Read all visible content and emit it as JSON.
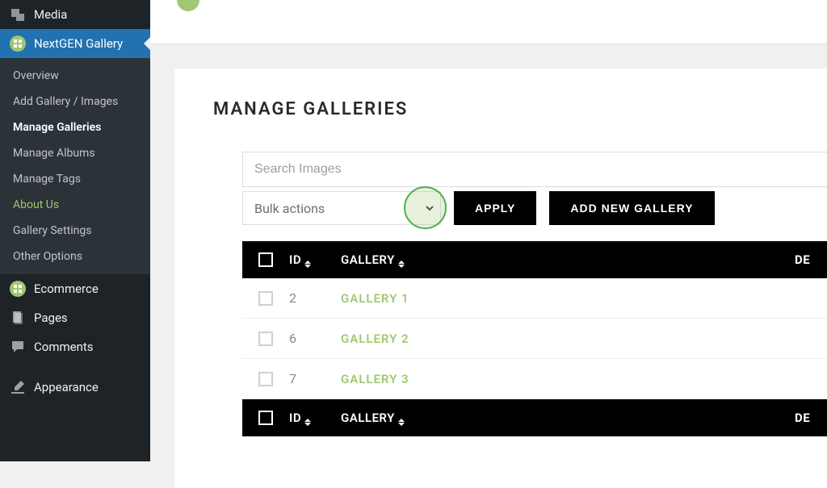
{
  "sidebar": {
    "media_label": "Media",
    "nextgen_label": "NextGEN Gallery",
    "submenu": [
      {
        "label": "Overview"
      },
      {
        "label": "Add Gallery / Images"
      },
      {
        "label": "Manage Galleries"
      },
      {
        "label": "Manage Albums"
      },
      {
        "label": "Manage Tags"
      },
      {
        "label": "About Us"
      },
      {
        "label": "Gallery Settings"
      },
      {
        "label": "Other Options"
      }
    ],
    "ecommerce_label": "Ecommerce",
    "pages_label": "Pages",
    "comments_label": "Comments",
    "appearance_label": "Appearance"
  },
  "page": {
    "title": "MANAGE GALLERIES",
    "search_placeholder": "Search Images",
    "bulk_label": "Bulk actions",
    "apply_label": "APPLY",
    "add_new_label": "ADD NEW GALLERY"
  },
  "table": {
    "header_id": "ID",
    "header_gallery": "GALLERY",
    "header_de": "DE",
    "rows": [
      {
        "id": "2",
        "name": "GALLERY 1"
      },
      {
        "id": "6",
        "name": "GALLERY 2"
      },
      {
        "id": "7",
        "name": "GALLERY 3"
      }
    ]
  }
}
